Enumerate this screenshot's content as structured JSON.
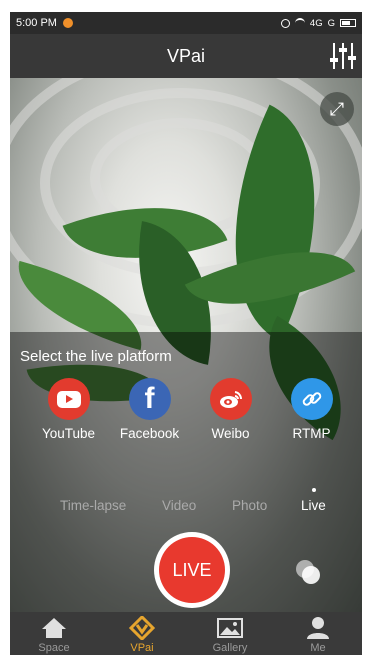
{
  "status_bar": {
    "time": "5:00 PM",
    "network": "4G",
    "carrier2": "G"
  },
  "header": {
    "title": "VPai"
  },
  "icons": {
    "settings": "sliders-icon",
    "expand": "expand-icon",
    "switch_camera": "switch-camera-icon"
  },
  "live": {
    "select_label": "Select the live platform",
    "platforms": [
      {
        "name": "YouTube",
        "icon": "youtube-icon",
        "color": "#e23b2e"
      },
      {
        "name": "Facebook",
        "icon": "facebook-icon",
        "color": "#3b66b5"
      },
      {
        "name": "Weibo",
        "icon": "weibo-icon",
        "color": "#e23b2e"
      },
      {
        "name": "RTMP",
        "icon": "link-icon",
        "color": "#2f97e8"
      }
    ],
    "button_label": "LIVE",
    "button_color": "#e8392e"
  },
  "modes": [
    {
      "label": "Time-lapse",
      "active": false
    },
    {
      "label": "Video",
      "active": false
    },
    {
      "label": "Photo",
      "active": false
    },
    {
      "label": "Live",
      "active": true
    }
  ],
  "bottom_nav": [
    {
      "label": "Space",
      "icon": "home-icon",
      "active": false
    },
    {
      "label": "VPai",
      "icon": "vpai-icon",
      "active": true
    },
    {
      "label": "Gallery",
      "icon": "gallery-icon",
      "active": false
    },
    {
      "label": "Me",
      "icon": "person-icon",
      "active": false
    }
  ],
  "colors": {
    "accent": "#e6a52e",
    "header_bg": "#383838",
    "nav_bg": "#3a3a3a"
  }
}
